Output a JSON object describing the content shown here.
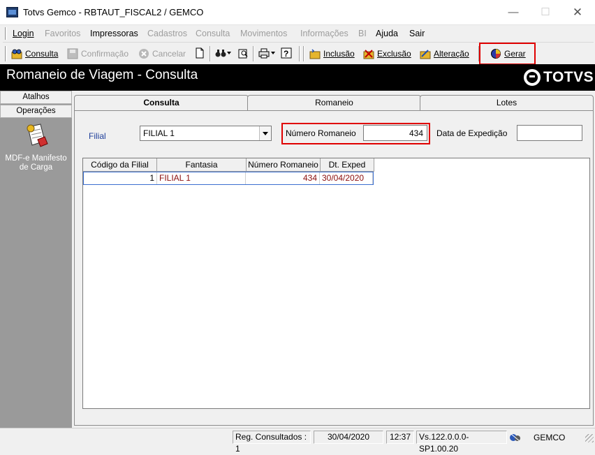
{
  "window": {
    "title": "Totvs Gemco - RBTAUT_FISCAL2 / GEMCO",
    "min_glyph": "—",
    "max_glyph": "☐",
    "close_glyph": "✕"
  },
  "menu": [
    {
      "label": "Login",
      "enabled": true
    },
    {
      "label": "Favoritos",
      "enabled": false
    },
    {
      "label": "Impressoras",
      "enabled": true
    },
    {
      "label": "Cadastros",
      "enabled": false
    },
    {
      "label": "Consulta",
      "enabled": false
    },
    {
      "label": "Movimentos",
      "enabled": false
    },
    {
      "label": "Informações",
      "enabled": false
    },
    {
      "label": "BI",
      "enabled": false
    },
    {
      "label": "Ajuda",
      "enabled": true
    },
    {
      "label": "Sair",
      "enabled": true
    }
  ],
  "toolbar": {
    "consulta": "Consulta",
    "confirmacao": "Confirmação",
    "cancelar": "Cancelar",
    "inclusao": "Inclusão",
    "exclusao": "Exclusão",
    "alteracao": "Alteração",
    "gerar": "Gerar"
  },
  "header": {
    "title": "Romaneio de Viagem  - Consulta",
    "logo": "TOTVS"
  },
  "left_panel": {
    "atalhos": "Atalhos",
    "operacoes": "Operações",
    "item_line1": "MDF-e Manifesto",
    "item_line2": "de Carga"
  },
  "tabs": [
    "Consulta",
    "Romaneio",
    "Lotes"
  ],
  "form": {
    "filial_label": "Filial",
    "filial_value": "FILIAL 1",
    "numero_label": "Número Romaneio",
    "numero_value": "434",
    "data_label": "Data de Expedição",
    "data_value": ""
  },
  "grid": {
    "columns": [
      "Código da Filial",
      "Fantasia",
      "Número Romaneio",
      "Dt. Exped"
    ],
    "rows": [
      {
        "codigo": "1",
        "fantasia": "FILIAL 1",
        "numero": "434",
        "data": "30/04/2020"
      }
    ]
  },
  "status": {
    "registros": "Reg. Consultados : 1",
    "date": "30/04/2020",
    "time": "12:37",
    "version": "Vs.122.0.0.0-SP1.00.20",
    "user": "GEMCO"
  },
  "colors": {
    "highlight": "#e00000",
    "header_band": "#000000",
    "row_text": "#8a0d0d",
    "filial_label": "#1f3f9a"
  }
}
